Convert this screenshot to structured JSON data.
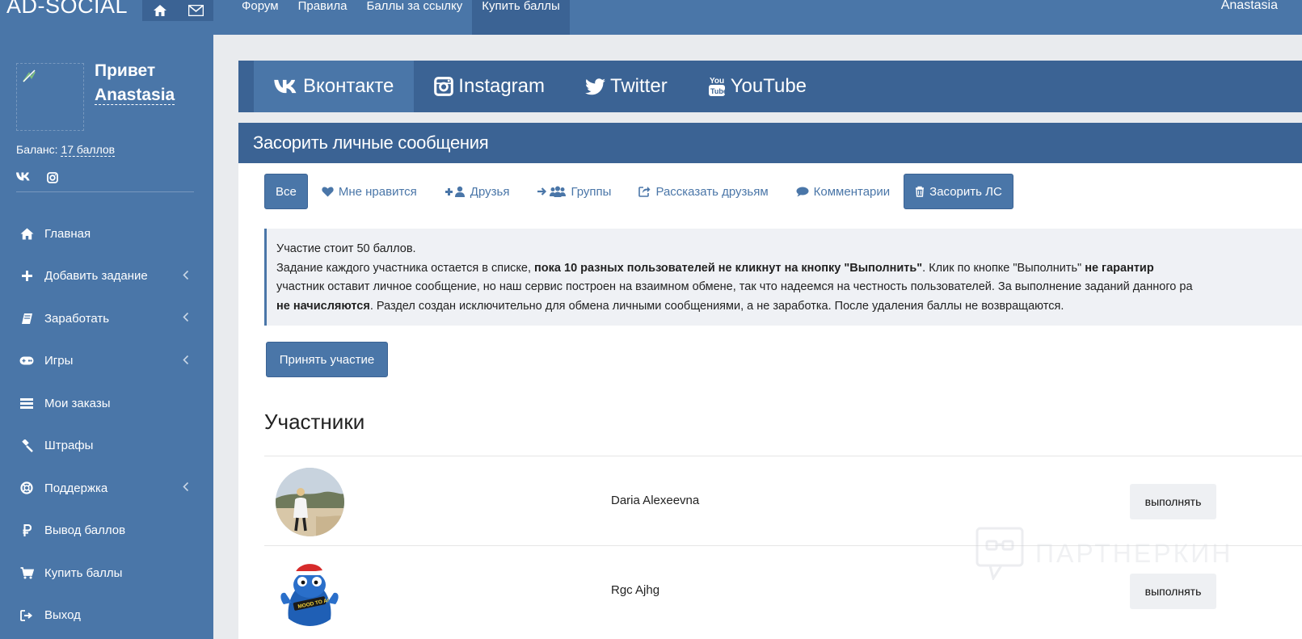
{
  "app": {
    "logo": "AD-SOCIAL",
    "user": "Anastasia"
  },
  "topnav": {
    "items": [
      "Форум",
      "Правила",
      "Баллы за ссылку",
      "Купить баллы"
    ],
    "active": 3
  },
  "sidebar": {
    "greeting": "Привет",
    "name": "Anastasia",
    "balance_label": "Баланс:",
    "balance_value": "17 баллов",
    "menu": [
      {
        "label": "Главная",
        "icon": "home-icon",
        "submenu": false
      },
      {
        "label": "Добавить задание",
        "icon": "plus-icon",
        "submenu": true
      },
      {
        "label": "Заработать",
        "icon": "book-icon",
        "submenu": true
      },
      {
        "label": "Игры",
        "icon": "gamepad-icon",
        "submenu": true
      },
      {
        "label": "Мои заказы",
        "icon": "list-icon",
        "submenu": false
      },
      {
        "label": "Штрафы",
        "icon": "gavel-icon",
        "submenu": false
      },
      {
        "label": "Поддержка",
        "icon": "lifebuoy-icon",
        "submenu": true
      },
      {
        "label": "Вывод баллов",
        "icon": "ruble-icon",
        "submenu": false
      },
      {
        "label": "Купить баллы",
        "icon": "cart-icon",
        "submenu": false
      },
      {
        "label": "Выход",
        "icon": "logout-icon",
        "submenu": false
      }
    ]
  },
  "tabs": {
    "items": [
      "Вконтакте",
      "Instagram",
      "Twitter",
      "YouTube"
    ],
    "active": 0
  },
  "panel": {
    "title": "Засорить личные сообщения",
    "filters": [
      "Все",
      "Мне нравится",
      "Друзья",
      "Группы",
      "Рассказать друзьям",
      "Комментарии",
      "Засорить ЛС"
    ],
    "notice": {
      "line1": "Участие стоит 50 баллов.",
      "line2_a": "Задание каждого участника остается в списке, ",
      "line2_b": "пока 10 разных пользователей не кликнут на кнопку \"Выполнить\"",
      "line2_c": ". Клик по кнопке \"Выполнить\" ",
      "line2_d": "не гарантир",
      "line3": "участник оставит личное сообщение, но наш сервис построен на взаимном обмене, так что надеемся на честность пользователей. За выполнение заданий данного ра",
      "line4_a": "не начисляются",
      "line4_b": ". Раздел создан исключительно для обмена личными сообщениями, а не заработка. После удаления баллы не возвращаются."
    },
    "join_button": "Принять участие",
    "participants_title": "Участники",
    "participants": [
      {
        "name": "Daria Alexeevna",
        "action": "выполнять"
      },
      {
        "name": "Rgc Ajhg",
        "action": "выполнять"
      }
    ]
  },
  "watermark": "ПАРТНЕРКИН"
}
